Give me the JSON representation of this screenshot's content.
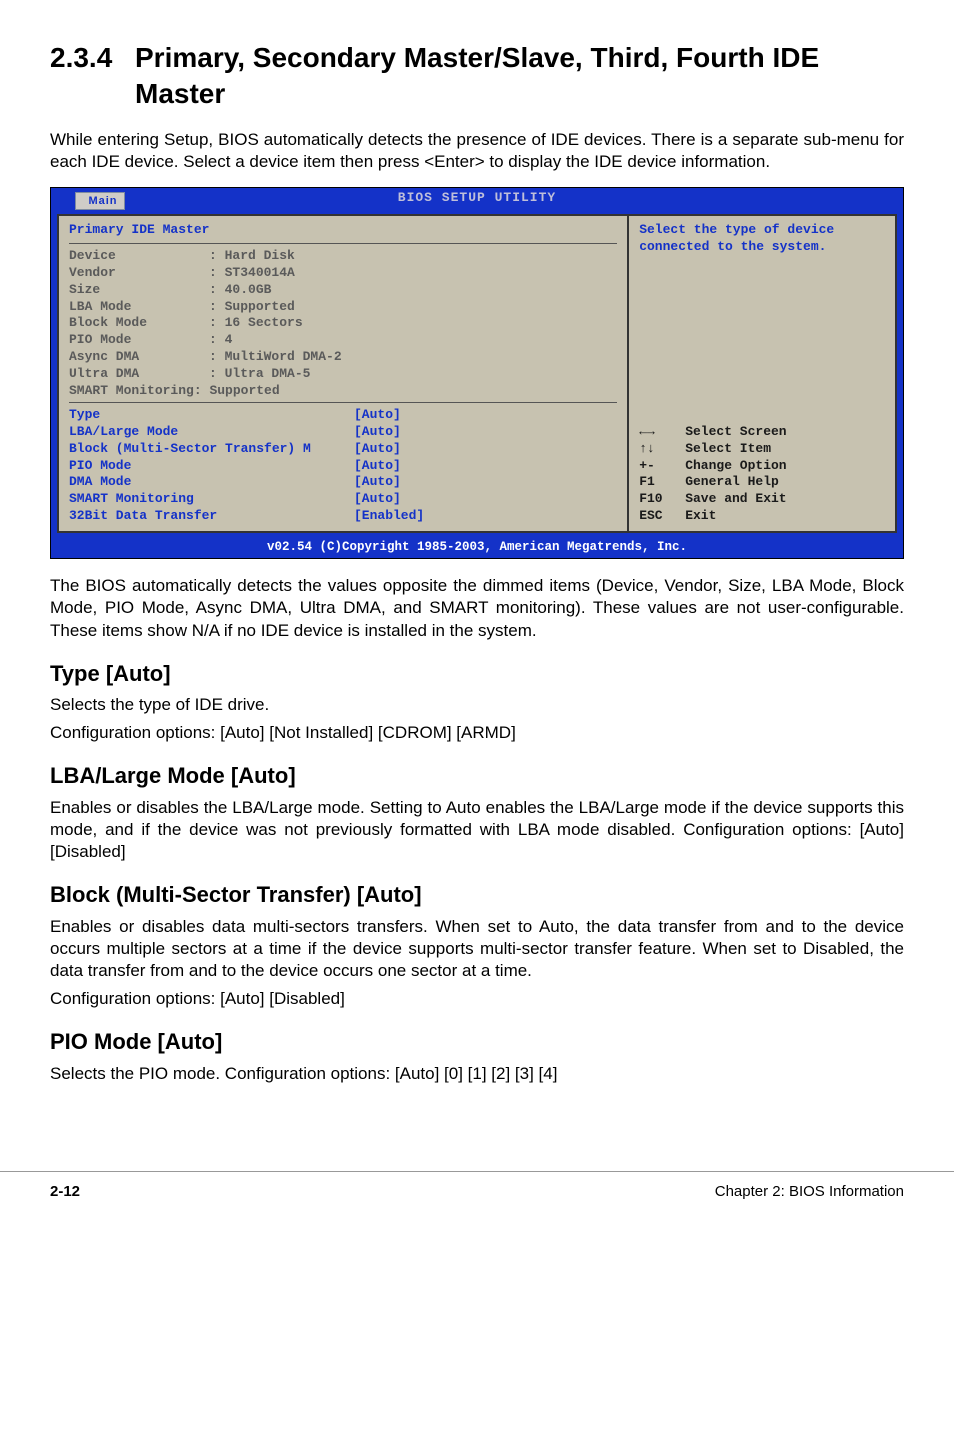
{
  "section": {
    "number": "2.3.4",
    "title": "Primary, Secondary Master/Slave, Third, Fourth IDE Master",
    "intro": "While entering Setup, BIOS automatically detects the presence of IDE devices. There is a separate sub-menu for each IDE device. Select a device item then press <Enter> to display the IDE device information."
  },
  "bios": {
    "utility_title": "BIOS SETUP UTILITY",
    "tab": "Main",
    "panel_title": "Primary IDE Master",
    "info": [
      {
        "label": "Device",
        "value": "Hard Disk"
      },
      {
        "label": "Vendor",
        "value": "ST340014A"
      },
      {
        "label": "Size",
        "value": "40.0GB"
      },
      {
        "label": "LBA Mode",
        "value": "Supported"
      },
      {
        "label": "Block Mode",
        "value": "16 Sectors"
      },
      {
        "label": "PIO Mode",
        "value": "4"
      },
      {
        "label": "Async DMA",
        "value": "MultiWord DMA-2"
      },
      {
        "label": "Ultra DMA",
        "value": "Ultra DMA-5"
      },
      {
        "label": "SMART Monitoring",
        "value": "Supported",
        "nolabelcolon": true
      }
    ],
    "config": [
      {
        "label": "Type",
        "value": "[Auto]"
      },
      {
        "label": "LBA/Large Mode",
        "value": "[Auto]"
      },
      {
        "label": "Block (Multi-Sector Transfer) M",
        "value": "[Auto]"
      },
      {
        "label": "PIO Mode",
        "value": "[Auto]"
      },
      {
        "label": "DMA Mode",
        "value": "[Auto]"
      },
      {
        "label": "SMART Monitoring",
        "value": "[Auto]"
      },
      {
        "label": "32Bit Data Transfer",
        "value": "[Enabled]"
      }
    ],
    "help_top": "Select the type of device connected to the system.",
    "help_keys": [
      {
        "k": "←→",
        "d": "Select Screen"
      },
      {
        "k": "↑↓",
        "d": "Select Item"
      },
      {
        "k": "+-",
        "d": "Change Option"
      },
      {
        "k": "F1",
        "d": "General Help"
      },
      {
        "k": "F10",
        "d": "Save and Exit"
      },
      {
        "k": "ESC",
        "d": "Exit"
      }
    ],
    "footer": "v02.54 (C)Copyright 1985-2003, American Megatrends, Inc."
  },
  "after_bios": "The BIOS automatically detects the values opposite the dimmed items (Device, Vendor, Size, LBA Mode, Block Mode, PIO Mode, Async DMA, Ultra DMA, and SMART monitoring). These values are not user-configurable. These items show N/A if no IDE device is installed in the system.",
  "subs": {
    "type": {
      "title": "Type [Auto]",
      "line1": "Selects the type of IDE drive.",
      "line2": "Configuration options: [Auto] [Not Installed] [CDROM] [ARMD]"
    },
    "lba": {
      "title": "LBA/Large Mode [Auto]",
      "text": "Enables or disables the LBA/Large mode. Setting to Auto enables the LBA/Large mode if the device supports this mode, and if the device was not previously formatted with LBA mode disabled. Configuration options: [Auto] [Disabled]"
    },
    "block": {
      "title": "Block (Multi-Sector Transfer) [Auto]",
      "text": "Enables or disables data multi-sectors transfers. When set to Auto, the data transfer from and to the device occurs multiple sectors at a time if the device supports multi-sector transfer feature. When set to Disabled, the data transfer from and to the device occurs one sector at a time.",
      "text2": " Configuration options: [Auto] [Disabled]"
    },
    "pio": {
      "title": "PIO Mode [Auto]",
      "text": "Selects the PIO mode. Configuration options: [Auto] [0] [1] [2] [3] [4]"
    }
  },
  "footer": {
    "page": "2-12",
    "chapter": "Chapter 2: BIOS Information"
  }
}
